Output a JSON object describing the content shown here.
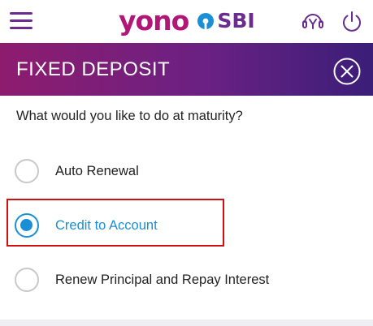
{
  "app": {
    "logo_text": "yono",
    "logo_brand": "SBI"
  },
  "icons": {
    "menu": "hamburger-menu-icon",
    "support": "headset-support-icon",
    "power": "power-logout-icon",
    "close": "close-circle-icon"
  },
  "header": {
    "title": "FIXED DEPOSIT"
  },
  "question": "What would you like to do at maturity?",
  "options": [
    {
      "label": "Auto Renewal",
      "selected": false
    },
    {
      "label": "Credit to Account",
      "selected": true
    },
    {
      "label": "Renew Principal and Repay Interest",
      "selected": false
    }
  ],
  "colors": {
    "brand_pink": "#b01776",
    "brand_purple": "#6a2c8e",
    "accent_blue": "#1a8fd6",
    "highlight_red": "#d10f0f"
  }
}
